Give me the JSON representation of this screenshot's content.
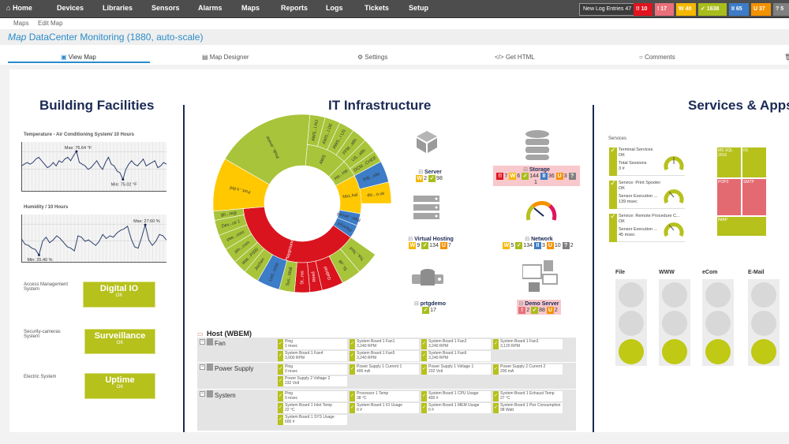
{
  "nav": {
    "items": [
      "Home",
      "Devices",
      "Libraries",
      "Sensors",
      "Alarms",
      "Maps",
      "Reports",
      "Logs",
      "Tickets",
      "Setup"
    ],
    "log_label": "New Log Entries",
    "log_count": "47",
    "badges": [
      {
        "icon": "!!",
        "count": "10",
        "color": "#e0141e"
      },
      {
        "icon": "!",
        "count": "17",
        "color": "#e9707a"
      },
      {
        "icon": "W",
        "count": "40",
        "color": "#f5b800"
      },
      {
        "icon": "✓",
        "count": "1638",
        "color": "#a8bd1c"
      },
      {
        "icon": "II",
        "count": "65",
        "color": "#3d7cc6"
      },
      {
        "icon": "U",
        "count": "37",
        "color": "#f39200"
      },
      {
        "icon": "?",
        "count": "5",
        "color": "#808080"
      }
    ]
  },
  "breadcrumb": [
    "Maps",
    "Edit Map"
  ],
  "title": {
    "prefix": "Map",
    "text": "DataCenter Monitoring (1880, auto-scale)"
  },
  "tabs": [
    "View Map",
    "Map Designer",
    "Settings",
    "Get HTML",
    "Comments"
  ],
  "building": {
    "heading": "Building Facilities",
    "temp": {
      "title": "Temperature - Air Conditioning System/ 10 Hours",
      "max": "Max: 76.64 °F",
      "min": "Min: 75.02 °F",
      "values": [
        75.8,
        75.9,
        76.0,
        75.9,
        76.0,
        76.2,
        76.3,
        76.1,
        75.9,
        75.7,
        75.8,
        76.0,
        75.8,
        76.1,
        76.0,
        76.2,
        76.3,
        76.1,
        76.4,
        76.64,
        76.0,
        75.9,
        75.8,
        75.6,
        75.7,
        75.9,
        76.1,
        75.8,
        75.6,
        76.0,
        76.3,
        75.9,
        75.8,
        75.5,
        75.4,
        75.02,
        75.6,
        75.9,
        76.1,
        75.9,
        75.8,
        76.0,
        76.2,
        75.8,
        75.9,
        76.0,
        76.1,
        75.7,
        75.8,
        76.0,
        75.9
      ]
    },
    "humidity": {
      "title": "Humidity / 10 Hours",
      "max": "Max: 27.60 %",
      "min": "Min: 25.40 %",
      "values": [
        26.6,
        26.2,
        26.1,
        25.9,
        25.8,
        25.4,
        26.4,
        26.7,
        26.3,
        26.5,
        26.8,
        26.6,
        26.3,
        26.0,
        25.9,
        25.7,
        26.8,
        26.7,
        26.4,
        26.5,
        26.3,
        26.1,
        26.4,
        26.9,
        26.6,
        26.8,
        26.7,
        27.0,
        27.2,
        27.3,
        27.5,
        26.6,
        26.0,
        25.9,
        26.7,
        27.6,
        26.5,
        26.1,
        26.4,
        26.9,
        26.8,
        26.5
      ]
    },
    "systems": [
      {
        "label": "Access Management System",
        "name": "Digital IO",
        "status": "OK"
      },
      {
        "label": "Security-cameras System",
        "name": "Surveillance",
        "status": "OK"
      },
      {
        "label": "Electric System",
        "name": "Uptime",
        "status": "OK"
      }
    ]
  },
  "it": {
    "heading": "IT Infrastructure",
    "groups": [
      {
        "name": "Server",
        "counts": [
          {
            "icon": "W",
            "n": "2",
            "color": "#f5b800"
          },
          {
            "icon": "✓",
            "n": "98",
            "color": "#a8bd1c"
          }
        ]
      },
      {
        "name": "Storage",
        "alert": true,
        "counts": [
          {
            "icon": "!!",
            "n": "7",
            "color": "#e0141e"
          },
          {
            "icon": "W",
            "n": "6",
            "color": "#f5b800"
          },
          {
            "icon": "✓",
            "n": "144",
            "color": "#a8bd1c"
          },
          {
            "icon": "II",
            "n": "36",
            "color": "#3d7cc6"
          },
          {
            "icon": "U",
            "n": "3",
            "color": "#f39200"
          },
          {
            "icon": "?",
            "n": "1",
            "color": "#808080"
          }
        ]
      },
      {
        "name": "Virtual Hosting",
        "counts": [
          {
            "icon": "W",
            "n": "9",
            "color": "#f5b800"
          },
          {
            "icon": "✓",
            "n": "134",
            "color": "#a8bd1c"
          },
          {
            "icon": "U",
            "n": "7",
            "color": "#f39200"
          }
        ]
      },
      {
        "name": "Network",
        "counts": [
          {
            "icon": "W",
            "n": "5",
            "color": "#f5b800"
          },
          {
            "icon": "✓",
            "n": "134",
            "color": "#a8bd1c"
          },
          {
            "icon": "II",
            "n": "3",
            "color": "#3d7cc6"
          },
          {
            "icon": "U",
            "n": "10",
            "color": "#f39200"
          },
          {
            "icon": "?",
            "n": "2",
            "color": "#808080"
          }
        ]
      },
      {
        "name": "prtgdemo",
        "counts": [
          {
            "icon": "✓",
            "n": "17",
            "color": "#a8bd1c"
          }
        ]
      },
      {
        "name": "Demo Server",
        "alert": true,
        "counts": [
          {
            "icon": "!",
            "n": "2",
            "color": "#e9707a"
          },
          {
            "icon": "✓",
            "n": "88",
            "color": "#a8bd1c"
          },
          {
            "icon": "U",
            "n": "2",
            "color": "#f39200"
          }
        ]
      }
    ],
    "host": {
      "title": "Host (WBEM)",
      "rows": [
        {
          "name": "Fan",
          "sensors": [
            [
              "Ping",
              "1 msec"
            ],
            [
              "System Board 1 Fan1",
              "3,240 RPM"
            ],
            [
              "System Board 1 Fan2",
              "3,240 RPM"
            ],
            [
              "System Board 1 Fan3",
              "3,120 RPM"
            ],
            [
              "System Board 1 Fan4",
              "3,000 RPM"
            ],
            [
              "System Board 1 Fan5",
              "3,240 RPM"
            ],
            [
              "System Board 1 Fan6",
              "3,240 RPM"
            ]
          ]
        },
        {
          "name": "Power Supply",
          "sensors": [
            [
              "Ping",
              "0 msec"
            ],
            [
              "Power Supply 1 Current 1",
              "400 mA"
            ],
            [
              "Power Supply 1 Voltage 1",
              "232 Volt"
            ],
            [
              "Power Supply 2 Current 2",
              "200 mA"
            ],
            [
              "Power Supply 2 Voltage 2",
              "232 Volt"
            ]
          ]
        },
        {
          "name": "System",
          "sensors": [
            [
              "Ping",
              "0 msec"
            ],
            [
              "Processor 1 Temp",
              "38 °C"
            ],
            [
              "System Board 1 CPU Usage",
              "400 #"
            ],
            [
              "System Board 1 Exhaust Temp",
              "27 °C"
            ],
            [
              "System Board 1 Inlet Temp",
              "22 °C"
            ],
            [
              "System Board 1 IO Usage",
              "0 #"
            ],
            [
              "System Board 1 MEM Usage",
              "0 #"
            ],
            [
              "System Board 1 Pwr Consumption",
              "98 Watt"
            ],
            [
              "System Board 1 SYS Usage",
              "600 #"
            ]
          ]
        }
      ]
    }
  },
  "chart_data": {
    "type": "sunburst",
    "start_angle_deg": -60,
    "inner": [
      {
        "label": "Prob...ervice",
        "value": 65,
        "color": "#a8c43a",
        "full": true
      },
      {
        "label": "AWS",
        "value": 40,
        "color": "#a8c43a"
      },
      {
        "label": "He...rop",
        "value": 17,
        "color": "#a8c43a"
      },
      {
        "label": "MxL.kal",
        "value": 38,
        "color": "#ffc800"
      },
      {
        "label": "Plan...anced",
        "value": 12,
        "color": "#3d7cc6"
      },
      {
        "label": "Planny4",
        "value": 13,
        "color": "#3d7cc6"
      },
      {
        "label": "Playground",
        "value": 140,
        "color": "#d9141e"
      },
      {
        "label": "Port...s.tbd",
        "value": 35,
        "color": "#ffc800",
        "full": true
      }
    ],
    "outer": [
      {
        "label": "",
        "value": 65
      },
      {
        "label": "AWS...I AU",
        "value": 10,
        "color": "#a8c43a"
      },
      {
        "label": "AWS...I DE",
        "value": 10,
        "color": "#a8c43a"
      },
      {
        "label": "AWS...I US",
        "value": 10,
        "color": "#a8c43a"
      },
      {
        "label": "FFM...alth",
        "value": 10,
        "color": "#a8c43a"
      },
      {
        "label": "US...alth",
        "value": 9,
        "color": "#a8c43a"
      },
      {
        "label": "DCM...CHEE",
        "value": 8,
        "color": "#a8c43a"
      },
      {
        "label": "IHE...elle",
        "value": 14,
        "color": "#3d7cc6"
      },
      {
        "label": "dic...o.uk",
        "value": 14,
        "color": "#ffc800"
      },
      {
        "label": "",
        "value": 35
      },
      {
        "label": "Tra...Test",
        "value": 15,
        "color": "#a8c43a"
      },
      {
        "label": "Si...all",
        "value": 13,
        "color": "#a8c43a"
      },
      {
        "label": "Gabriel",
        "value": 14,
        "color": "#d9141e"
      },
      {
        "label": "Reed",
        "value": 8,
        "color": "#d9141e"
      },
      {
        "label": "St...ros",
        "value": 10,
        "color": "#d9141e"
      },
      {
        "label": "Sys...Wall",
        "value": 10,
        "color": "#a8c43a"
      },
      {
        "label": "Led...robe",
        "value": 15,
        "color": "#3d7cc6"
      },
      {
        "label": "Jochen",
        "value": 10,
        "color": "#a8c43a"
      },
      {
        "label": "Wat...P300",
        "value": 9,
        "color": "#a8c43a"
      },
      {
        "label": "pin...com",
        "value": 10,
        "color": "#a8c43a"
      },
      {
        "label": "pse...com",
        "value": 10,
        "color": "#a8c43a"
      },
      {
        "label": "Dev...ce 1",
        "value": 10,
        "color": "#a8c43a"
      },
      {
        "label": "go...regi",
        "value": 6,
        "color": "#a8c43a"
      },
      {
        "label": "",
        "value": 35
      }
    ]
  },
  "services": {
    "heading": "Services & Apps",
    "label": "Services",
    "items": [
      {
        "name": "Terminal Services",
        "status": "OK",
        "metric": "Total Sessions",
        "value": "3 #",
        "gauge": 0.5
      },
      {
        "name": "Service: Print Spooler",
        "status": "OK",
        "metric": "Sensor Execution ...",
        "value": "139 msec",
        "gauge": 0.35
      },
      {
        "name": "Service: Remote Procedure C...",
        "status": "OK",
        "metric": "Sensor Execution ...",
        "value": "45 msec",
        "gauge": 0.35
      }
    ],
    "treemap": [
      {
        "label": "MS SQL 2016",
        "color": "#b6c11c"
      },
      {
        "label": "IIS",
        "color": "#b6c11c"
      },
      {
        "label": "POP3",
        "color": "#e46a72"
      },
      {
        "label": "SMTP",
        "color": "#e46a72"
      },
      {
        "label": "IMAP",
        "color": "#b6c11c"
      }
    ],
    "lights": [
      {
        "label": "File",
        "state": "green"
      },
      {
        "label": "WWW",
        "state": "green"
      },
      {
        "label": "eCom",
        "state": "green"
      },
      {
        "label": "E-Mail",
        "state": "green"
      }
    ]
  }
}
